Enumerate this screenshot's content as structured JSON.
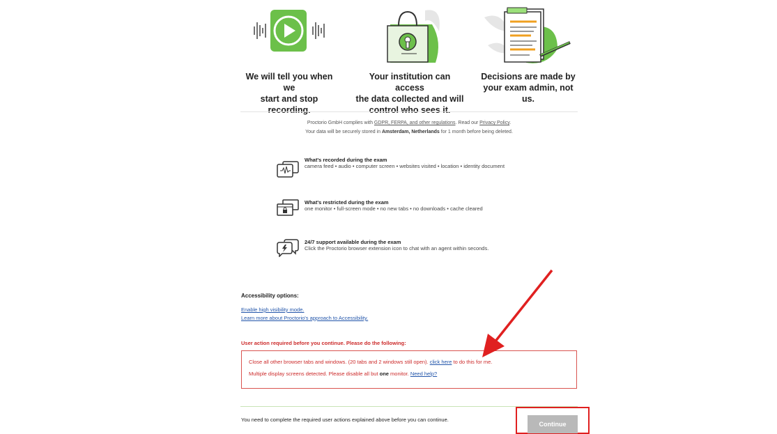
{
  "features": [
    {
      "icon": "play-recording-icon",
      "line1": "We will tell you when we",
      "line2": "start and stop recording.",
      "line3": ""
    },
    {
      "icon": "lock-bag-icon",
      "line1": "Your institution can access",
      "line2": "the data collected and will",
      "line3": "control who sees it."
    },
    {
      "icon": "document-icon",
      "line1": "Decisions are made by",
      "line2": "your exam admin, not us.",
      "line3": ""
    }
  ],
  "compliance": {
    "prefix": "Proctorio GmbH complies with ",
    "regs_link": "GDPR, FERPA, and other regulations",
    "mid": ". Read our ",
    "privacy_link": "Privacy Policy",
    "end": ".",
    "storage_prefix": "Your data will be securely stored in ",
    "storage_location": "Amsterdam, Netherlands",
    "storage_suffix": " for 1 month before being deleted."
  },
  "info": [
    {
      "icon": "recording-waveform-icon",
      "title": "What's recorded during the exam",
      "desc": "camera feed • audio • computer screen • websites visited • location • identity document"
    },
    {
      "icon": "locked-windows-icon",
      "title": "What's restricted during the exam",
      "desc": "one monitor • full-screen mode • no new tabs • no downloads • cache cleared"
    },
    {
      "icon": "chat-support-icon",
      "title": "24/7 support available during the exam",
      "desc": "Click the Proctorio browser extension icon to chat with an agent within seconds."
    }
  ],
  "accessibility": {
    "heading": "Accessibility options:",
    "link1": "Enable high visibility mode.",
    "link2": "Learn more about Proctorio's approach to Accessibility."
  },
  "requirements": {
    "heading": "User action required before you continue. Please do the following:",
    "item1_prefix": "Close all other browser tabs and windows. (20 tabs and 2 windows still open). ",
    "item1_link": "click here",
    "item1_suffix": " to do this for me.",
    "item2_prefix": "Multiple display screens detected. Please disable all but ",
    "item2_bold": "one",
    "item2_mid": " monitor. ",
    "item2_link": "Need help?"
  },
  "footer": {
    "text": "You need to complete the required user actions explained above before you can continue.",
    "continue_label": "Continue"
  },
  "colors": {
    "accent_green": "#6cc04a",
    "error_red": "#cc2b2b",
    "link_blue": "#2255aa",
    "annotation_red": "#e02020"
  }
}
